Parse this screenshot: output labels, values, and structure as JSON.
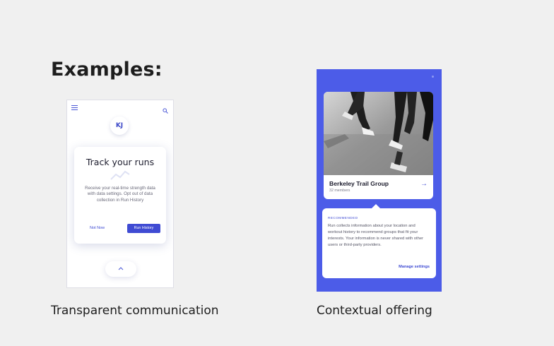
{
  "heading": "Examples:",
  "captions": {
    "left": "Transparent communication",
    "right": "Contextual offering"
  },
  "left_phone": {
    "avatar_initials": "KJ",
    "card": {
      "title": "Track your runs",
      "body": "Receive your real-time strength data with data settings. Opt out of data collection in Run History",
      "not_now_label": "Not Now",
      "run_history_label": "Run History"
    }
  },
  "right_phone": {
    "card": {
      "title": "Berkeley Trail Group",
      "subtitle": "32 members"
    },
    "info": {
      "kicker": "RECOMMENDED",
      "body": "Run collects information about your location and workout history to recommend groups that fit your interests. Your information is never shared with other users or third-party providers.",
      "manage_label": "Manage settings"
    }
  },
  "colors": {
    "accent": "#3f4bd3",
    "panel_blue": "#4c5ce8",
    "background": "#f0f0f0"
  }
}
